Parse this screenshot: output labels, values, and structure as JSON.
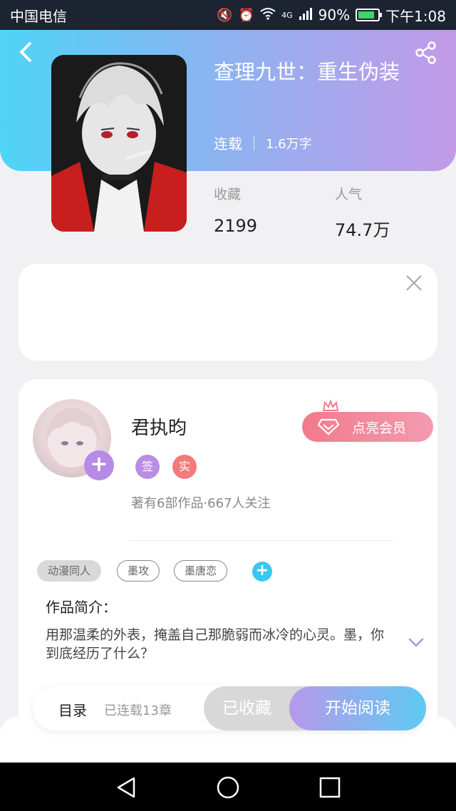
{
  "status_bar": {
    "carrier": "中国电信",
    "network": "4G",
    "battery": "90%",
    "time": "下午1:08"
  },
  "book": {
    "title": "查理九世：重生伪装",
    "status": "连载",
    "word_count": "1.6万字",
    "stats": [
      {
        "label": "收藏",
        "value": "2199"
      },
      {
        "label": "人气",
        "value": "74.7万"
      }
    ]
  },
  "author": {
    "name": "君执昀",
    "badges": [
      "签",
      "实"
    ],
    "summary": "著有6部作品·667人关注",
    "vip_button": "点亮会员"
  },
  "tags": [
    "动漫同人",
    "墨攻",
    "墨唐恋"
  ],
  "intro": {
    "heading": "作品简介：",
    "text": "用那温柔的外表，掩盖自己那脆弱而冰冷的心灵。墨，你到底经历了什么？"
  },
  "action_bar": {
    "catalog": "目录",
    "chapters": "已连载13章",
    "collected": "已收藏",
    "read": "开始阅读"
  },
  "colors": {
    "header_start": "#4fd4f7",
    "header_end": "#c39ae8",
    "accent_purple": "#b68ae6",
    "accent_blue": "#39c8f1",
    "vip_pink": "#f27a8a"
  }
}
